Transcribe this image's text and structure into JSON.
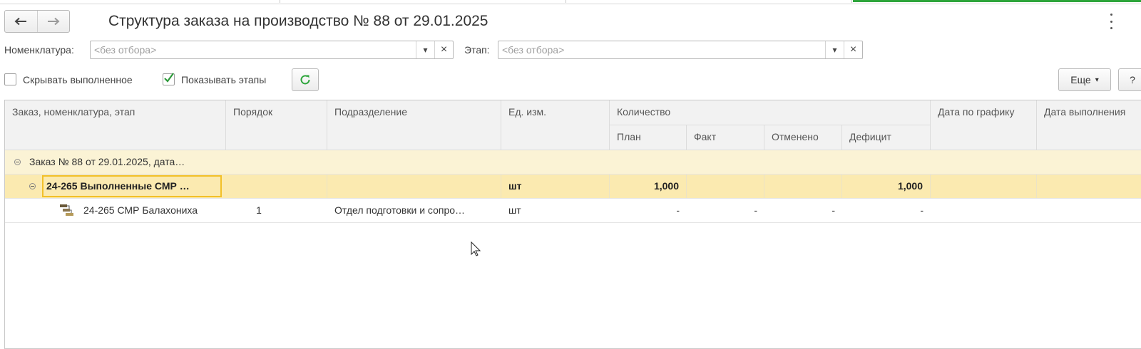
{
  "window": {
    "title": "Структура заказа на производство № 88 от 29.01.2025"
  },
  "filters": {
    "nomenclature_label": "Номенклатура:",
    "nomenclature_placeholder": "<без отбора>",
    "stage_label": "Этап:",
    "stage_placeholder": "<без отбора>",
    "dropdown_glyph": "▾",
    "clear_glyph": "×"
  },
  "options": {
    "hide_completed_label": "Скрывать выполненное",
    "hide_completed_checked": false,
    "show_stages_label": "Показывать этапы",
    "show_stages_checked": true
  },
  "toolbar": {
    "more_label": "Еще",
    "more_arrow": "▾",
    "help_label": "?"
  },
  "table": {
    "headers": {
      "order": "Заказ, номенклатура, этап",
      "sequence": "Порядок",
      "department": "Подразделение",
      "unit": "Ед. изм.",
      "quantity": "Количество",
      "plan": "План",
      "fact": "Факт",
      "cancelled": "Отменено",
      "deficit": "Дефицит",
      "scheduled_date": "Дата по графику",
      "completion_date": "Дата выполнения"
    },
    "rows": [
      {
        "name": "Заказ № 88 от 29.01.2025, дата…",
        "sequence": "",
        "department": "",
        "unit": "",
        "plan": "",
        "fact": "",
        "cancelled": "",
        "deficit": ""
      },
      {
        "name": "24-265 Выполненные СМР …",
        "sequence": "",
        "department": "",
        "unit": "шт",
        "plan": "1,000",
        "fact": "",
        "cancelled": "",
        "deficit": "1,000"
      },
      {
        "name": "24-265 СМР Балахониха",
        "sequence": "1",
        "department": "Отдел подготовки и сопро…",
        "unit": "шт",
        "plan": "-",
        "fact": "-",
        "cancelled": "-",
        "deficit": "-"
      }
    ]
  },
  "colors": {
    "row_highlight": "#fbf3d5",
    "row_selected": "#fbeab0",
    "selected_border": "#f2c029",
    "refresh_green": "#2da53b",
    "check_green": "#2f9a3c"
  }
}
